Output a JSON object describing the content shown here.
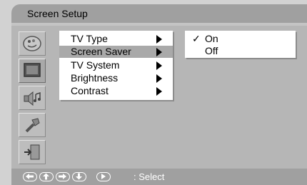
{
  "title": "Screen Setup",
  "icons": [
    "picture-icon",
    "tv-screen-icon",
    "audio-icon",
    "tools-icon",
    "exit-icon"
  ],
  "menu": {
    "items": [
      {
        "label": "TV Type",
        "highlighted": false
      },
      {
        "label": "Screen Saver",
        "highlighted": true
      },
      {
        "label": "TV System",
        "highlighted": false
      },
      {
        "label": "Brightness",
        "highlighted": false
      },
      {
        "label": "Contrast",
        "highlighted": false
      }
    ]
  },
  "submenu": {
    "items": [
      {
        "label": "On",
        "checked": true,
        "check_mark": "✓"
      },
      {
        "label": "Off",
        "checked": false
      }
    ]
  },
  "footer": {
    "buttons": [
      "left-arrow-icon",
      "up-arrow-icon",
      "right-arrow-icon",
      "down-arrow-icon",
      "play-icon"
    ],
    "hint": ": Select"
  },
  "colors": {
    "background": "#d2d2d2",
    "title_bar": "#a0a0a0",
    "highlight": "#a9a9a9",
    "menu_bg": "#ffffff"
  }
}
